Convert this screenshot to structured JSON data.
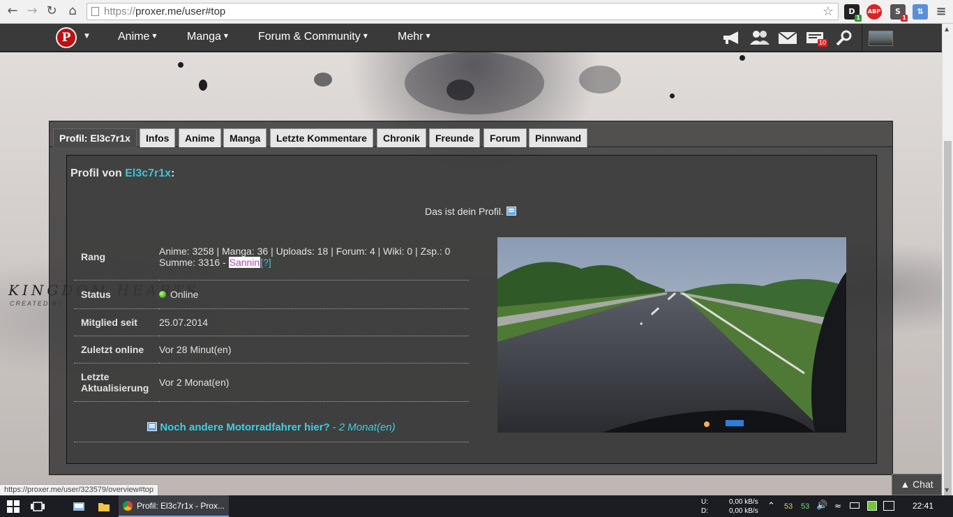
{
  "browser": {
    "url_scheme": "https://",
    "url_rest": "proxer.me/user#top",
    "status_url": "https://proxer.me/user/323579/overview#top",
    "ext_badge_d": "1",
    "ext_badge_s": "1",
    "abp_label": "ABP"
  },
  "site": {
    "logo_letter": "P",
    "menu": [
      "Anime",
      "Manga",
      "Forum & Community",
      "Mehr"
    ],
    "notifications_count": "10",
    "bg_logo": "KINGDOM HEARTS",
    "bg_logo_sub": "CREATED BY"
  },
  "profile": {
    "tabs": [
      "Profil: El3c7r1x",
      "Infos",
      "Anime",
      "Manga",
      "Letzte Kommentare",
      "Chronik",
      "Freunde",
      "Forum",
      "Pinnwand"
    ],
    "heading_prefix": "Profil von",
    "username": "El3c7r1x",
    "heading_suffix": ":",
    "own_note": "Das ist dein Profil.",
    "rows": {
      "rank_label": "Rang",
      "rank_stats": "Anime: 3258 | Manga: 36 | Uploads: 18 | Forum: 4 | Wiki: 0 | Zsp.: 0",
      "rank_sum": "Summe: 3316 -",
      "rank_name": "Sannin",
      "rank_help": "[?]",
      "status_label": "Status",
      "status_value": "Online",
      "member_label": "Mitglied seit",
      "member_value": "25.07.2014",
      "last_online_label": "Zuletzt online",
      "last_online_value": "Vor 28 Minut(en)",
      "last_update_label": "Letzte Aktualisierung",
      "last_update_value": "Vor 2 Monat(en)"
    },
    "news_link": "Noch andere Motorradfahrer hier?",
    "news_time": "- 2 Monat(en)"
  },
  "chat_label": "▲ Chat",
  "taskbar": {
    "task_label": "Profil: El3c7r1x - Prox...",
    "net_up_label": "U:",
    "net_down_label": "D:",
    "net_up": "0,00 kB/s",
    "net_down": "0,00 kB/s",
    "temp1": "53",
    "temp2": "53",
    "clock": "22:41"
  },
  "colors": {
    "accent_cyan": "#39c5d6",
    "rank_color": "#b444b4",
    "nav_bg": "#3a3a3a"
  }
}
